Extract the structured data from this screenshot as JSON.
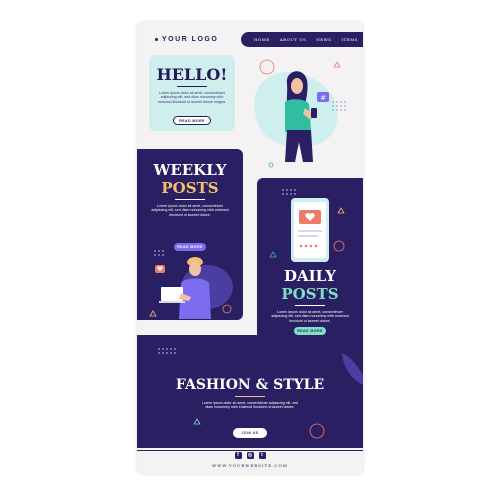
{
  "header": {
    "logo_text": "YOUR LOGO",
    "nav": [
      "HOME",
      "ABOUT US",
      "NEWS",
      "ITEMS"
    ]
  },
  "hello": {
    "title": "HELLO!",
    "body": "Lorem ipsum dolor sit amet, consectetuer adipiscing elit, sed diam nonummy nibh euismod tincidunt ut laoreet dolore magna.",
    "button": "READ MORE"
  },
  "weekly": {
    "title_line1": "WEEKLY",
    "title_line2": "POSTS",
    "body": "Lorem ipsum dolor sit amet, consectetuer adipiscing elit, sed diam nonummy nibh euismod tincidunt ut laoreet dolore.",
    "button": "READ MORE"
  },
  "daily": {
    "title_line1": "DAILY",
    "title_line2": "POSTS",
    "body": "Lorem ipsum dolor sit amet, consectetuer adipiscing elit, sed diam nonummy nibh euismod tincidunt ut laoreet dolore.",
    "button": "READ MORE"
  },
  "fashion": {
    "title": "FASHION & STYLE",
    "body": "Lorem ipsum dolor sit amet, consectetuer adipiscing elit, sed diam nonummy nibh euismod tincidunt ut laoreet dolore.",
    "button": "JOIN US"
  },
  "footer": {
    "social": [
      "facebook-icon",
      "instagram-icon",
      "twitter-icon"
    ],
    "website": "WWW.YOURWEBSITE.COM"
  },
  "colors": {
    "navy": "#2a1f63",
    "mint": "#cfeeee",
    "gold": "#f4c06c",
    "green": "#7fe0c2",
    "coral": "#f07a6a"
  }
}
